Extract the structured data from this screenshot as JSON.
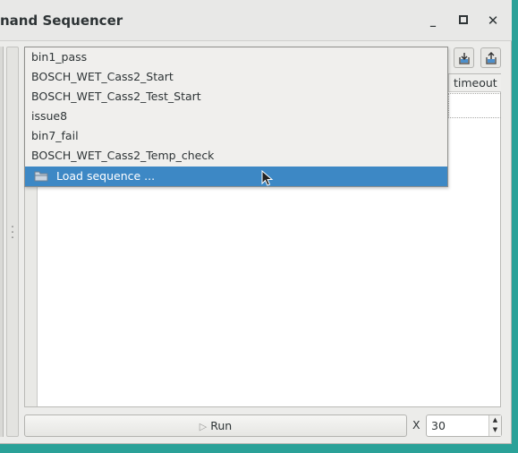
{
  "window": {
    "title": "nand Sequencer",
    "minimize_glyph": "_",
    "maximize_glyph": "▫",
    "close_glyph": "✕"
  },
  "toolbar": {
    "export_icon": "export-file-icon",
    "import_icon": "import-file-icon"
  },
  "table": {
    "columns": [
      "timeout"
    ]
  },
  "dropdown": {
    "items": [
      "bin1_pass",
      "BOSCH_WET_Cass2_Start",
      "BOSCH_WET_Cass2_Test_Start",
      "issue8",
      "bin7_fail",
      "BOSCH_WET_Cass2_Temp_check"
    ],
    "action_label": "Load sequence ..."
  },
  "footer": {
    "run_label": "Run",
    "repeat_label": "X",
    "repeat_value": "30"
  },
  "colors": {
    "desktop": "#2aa198",
    "selection": "#3d88c5"
  }
}
